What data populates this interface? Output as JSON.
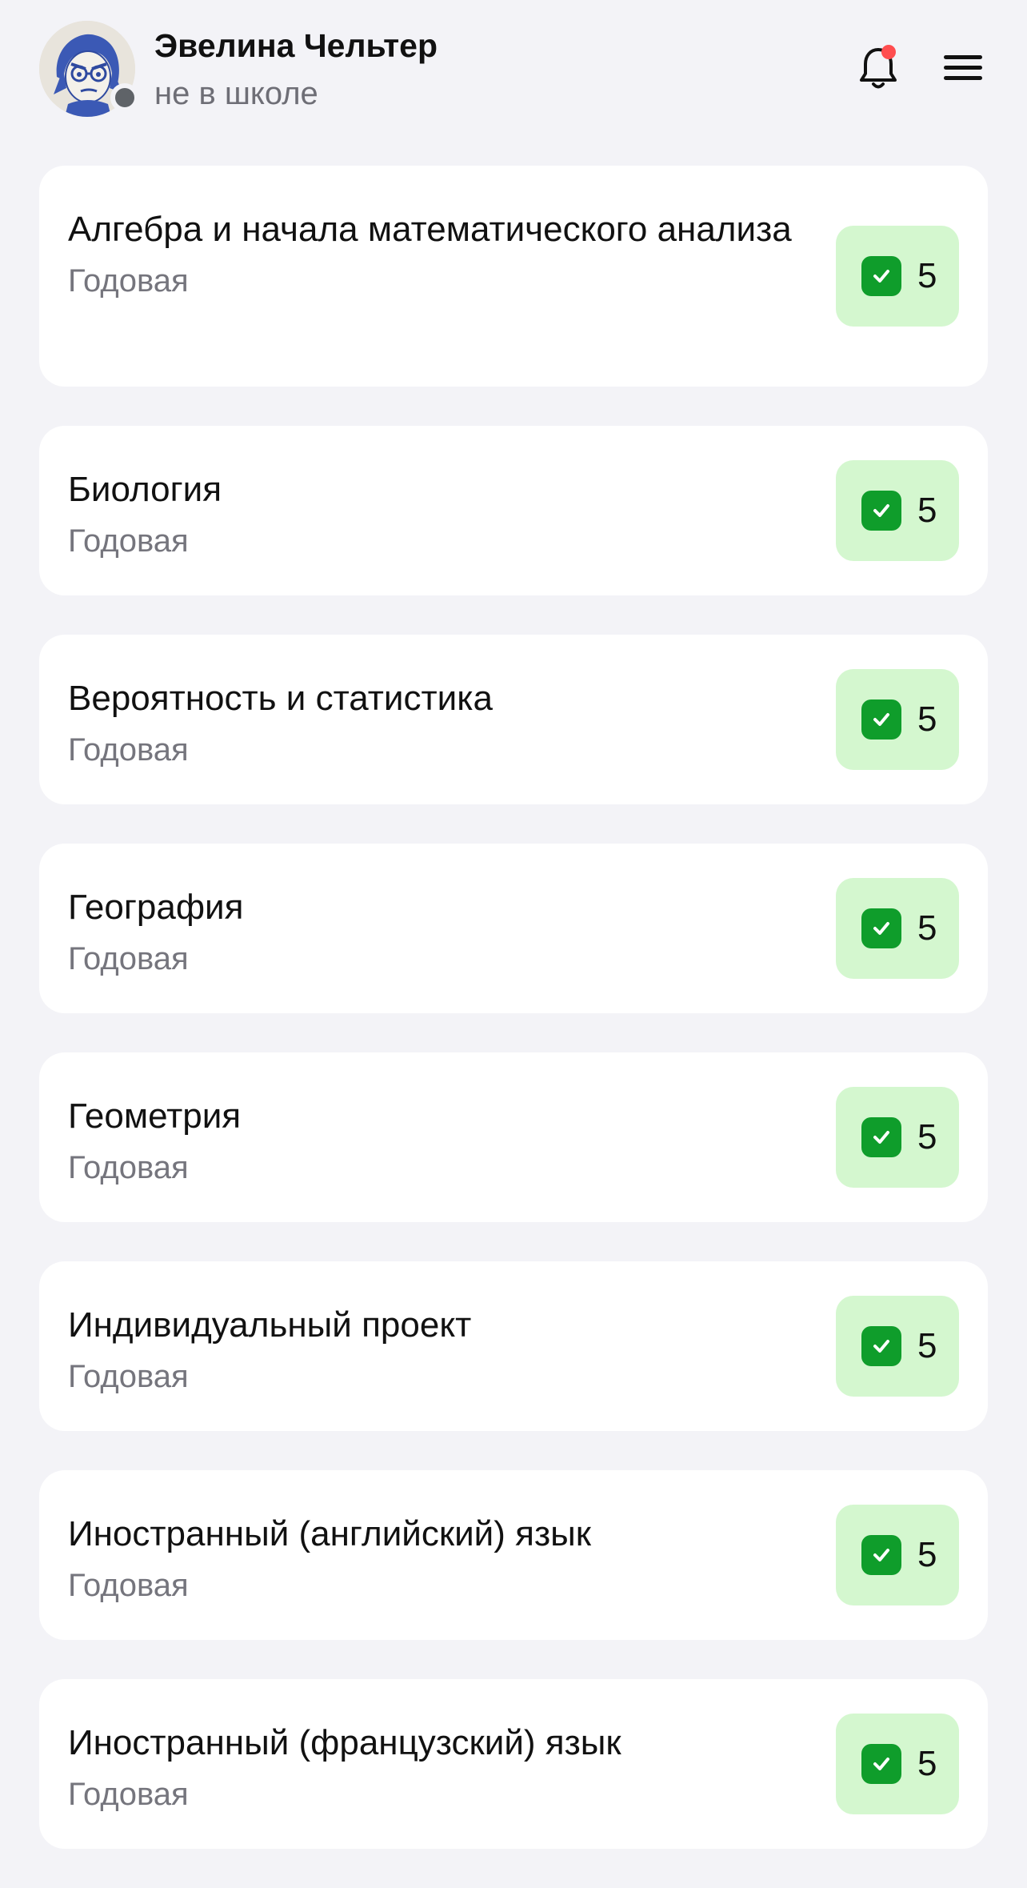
{
  "header": {
    "user_name": "Эвелина Чельтер",
    "user_status": "не в школе",
    "avatar_icon": "avatar-illustration",
    "bell_icon": "bell-icon",
    "menu_icon": "hamburger-menu-icon",
    "notification_dot_color": "#ff4d4f",
    "presence_color": "#5f6368"
  },
  "grades": [
    {
      "subject": "Алгебра и начала математического анализа",
      "period": "Годовая",
      "grade": "5"
    },
    {
      "subject": "Биология",
      "period": "Годовая",
      "grade": "5"
    },
    {
      "subject": "Вероятность и статистика",
      "period": "Годовая",
      "grade": "5"
    },
    {
      "subject": "География",
      "period": "Годовая",
      "grade": "5"
    },
    {
      "subject": "Геометрия",
      "period": "Годовая",
      "grade": "5"
    },
    {
      "subject": "Индивидуальный проект",
      "period": "Годовая",
      "grade": "5"
    },
    {
      "subject": "Иностранный (английский) язык",
      "period": "Годовая",
      "grade": "5"
    },
    {
      "subject": "Иностранный (французский) язык",
      "period": "Годовая",
      "grade": "5"
    }
  ],
  "colors": {
    "background": "#f3f3f7",
    "card": "#ffffff",
    "grade_chip": "#d4f7cf",
    "check_green": "#0f9d2b",
    "secondary_text": "#75757d"
  }
}
